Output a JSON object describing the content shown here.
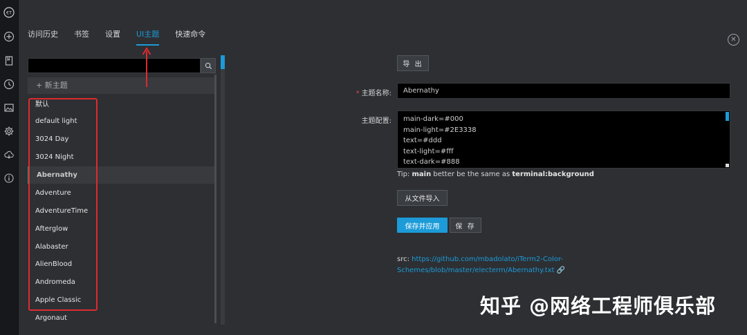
{
  "tabs": [
    {
      "label": "访问历史",
      "active": false
    },
    {
      "label": "书签",
      "active": false
    },
    {
      "label": "设置",
      "active": false
    },
    {
      "label": "UI主题",
      "active": true
    },
    {
      "label": "快速命令",
      "active": false
    }
  ],
  "sidebar_icons": [
    "logo-icon",
    "plus-circle-icon",
    "bookmark-icon",
    "clock-icon",
    "image-icon",
    "gear-icon",
    "cloud-sync-icon",
    "info-icon"
  ],
  "theme_panel": {
    "search_value": "",
    "new_theme_label": "+ 新主题",
    "themes": [
      "默认",
      "default light",
      "3024 Day",
      "3024 Night",
      "Abernathy",
      "Adventure",
      "AdventureTime",
      "Afterglow",
      "Alabaster",
      "AlienBlood",
      "Andromeda",
      "Apple Classic",
      "Argonaut"
    ],
    "active_theme": "Abernathy"
  },
  "form": {
    "export_label": "导 出",
    "name_label": "主题名称:",
    "name_value": "Abernathy",
    "config_label": "主题配置:",
    "config_lines": [
      "main-dark=#000",
      "main-light=#2E3338",
      "text=#ddd",
      "text-light=#fff",
      "text-dark=#888"
    ],
    "tip_prefix": "Tip: ",
    "tip_main": "main",
    "tip_middle": " better be the same as ",
    "tip_bg": "terminal:background",
    "import_label": "从文件导入",
    "save_apply_label": "保存并应用",
    "save_label": "保 存",
    "src_prefix": "src: ",
    "src_link": "https://github.com/mbadolato/iTerm2-Color-Schemes/blob/master/electerm/Abernathy.txt"
  },
  "watermark": "知乎 @网络工程师俱乐部",
  "colors": {
    "accent": "#1c9bd8",
    "active_marker": "#1aa179",
    "annotation": "#e02a2f",
    "required": "#e0484b"
  }
}
